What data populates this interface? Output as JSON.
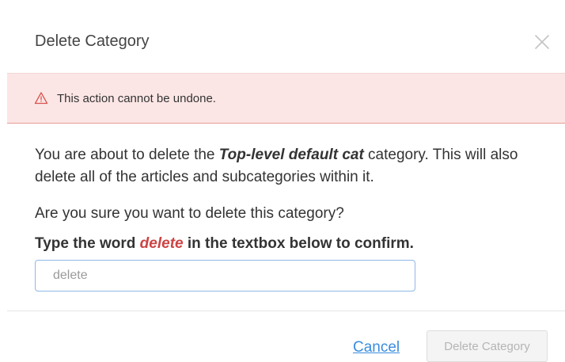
{
  "dialog": {
    "title": "Delete Category",
    "close_icon": "close-icon"
  },
  "alert": {
    "icon": "warning-triangle-icon",
    "text": "This action cannot be undone.",
    "colors": {
      "background": "#fbe6e5",
      "icon": "#d9534f"
    }
  },
  "message": {
    "p1_before": "You are about to delete the ",
    "category_name": "Top-level default cat",
    "p1_after": " category. This will also delete all of the articles and subcategories within it.",
    "question": "Are you sure you want to delete this category?",
    "confirm_before": "Type the word ",
    "confirm_word": "delete",
    "confirm_after": " in the textbox below to confirm."
  },
  "input": {
    "placeholder": "delete",
    "value": ""
  },
  "footer": {
    "cancel_label": "Cancel",
    "delete_label": "Delete Category",
    "delete_disabled": true,
    "colors": {
      "link": "#3a8dde"
    }
  }
}
